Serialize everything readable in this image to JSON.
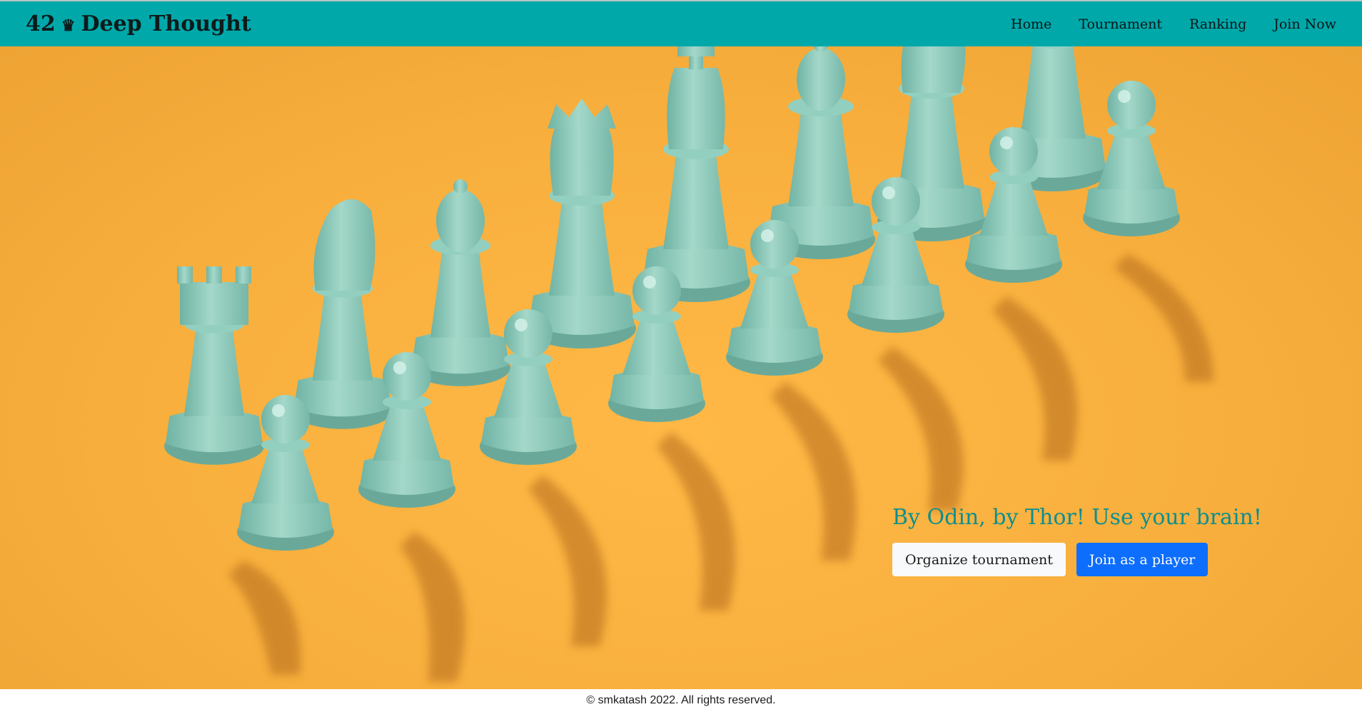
{
  "brand": {
    "number": "42",
    "crown_icon": "♛",
    "name": "Deep Thought"
  },
  "nav": {
    "items": [
      {
        "label": "Home"
      },
      {
        "label": "Tournament"
      },
      {
        "label": "Ranking"
      },
      {
        "label": "Join Now"
      }
    ]
  },
  "hero": {
    "tagline": "By Odin, by Thor! Use your brain!",
    "buttons": {
      "organize": "Organize tournament",
      "join": "Join as a player"
    },
    "colors": {
      "background": "#f7ae3c",
      "pieces": "#8fcbbc",
      "accent": "#0b8f8f"
    }
  },
  "footer": {
    "text": "© smkatash 2022. All rights reserved."
  }
}
